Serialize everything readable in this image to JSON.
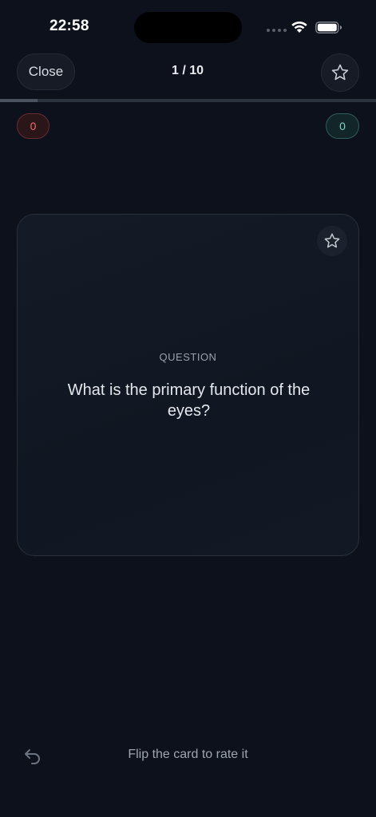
{
  "status_bar": {
    "time": "22:58",
    "icons": [
      "signal-dots-icon",
      "wifi-icon",
      "battery-icon"
    ]
  },
  "top_bar": {
    "close_label": "Close",
    "progress_text": "1 / 10",
    "progress_fraction": 0.1,
    "favorite_icon": "star-outline-icon"
  },
  "counters": {
    "wrong": "0",
    "correct": "0"
  },
  "card": {
    "label": "QUESTION",
    "question": "What is the primary function of the eyes?",
    "favorite_icon": "star-outline-icon"
  },
  "footer": {
    "undo_icon": "undo-arrow-icon",
    "hint": "Flip the card to rate it"
  },
  "colors": {
    "background": "#0c111b",
    "wrong_accent": "#f06a6a",
    "correct_accent": "#7fd3c1"
  }
}
